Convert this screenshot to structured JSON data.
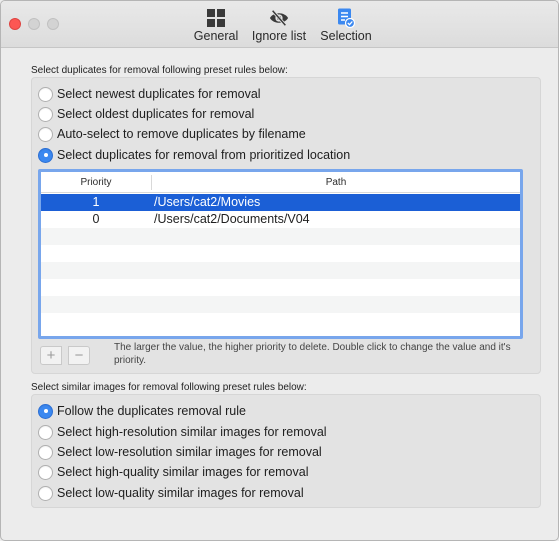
{
  "window": {
    "toolbar": [
      {
        "label": "General",
        "icon": "grid-icon"
      },
      {
        "label": "Ignore list",
        "icon": "eye-slash-icon"
      },
      {
        "label": "Selection",
        "icon": "checklist-icon"
      }
    ]
  },
  "duplicates": {
    "section_label": "Select duplicates for removal following preset rules below:",
    "options": [
      {
        "label": "Select newest duplicates for removal",
        "selected": false
      },
      {
        "label": "Select oldest duplicates for removal",
        "selected": false
      },
      {
        "label": "Auto-select to remove duplicates by filename",
        "selected": false
      },
      {
        "label": "Select duplicates for removal from prioritized location",
        "selected": true
      }
    ],
    "table": {
      "headers": [
        "Priority",
        "Path"
      ],
      "rows": [
        {
          "priority": "1",
          "path": "/Users/cat2/Movies",
          "selected": true
        },
        {
          "priority": "0",
          "path": "/Users/cat2/Documents/V04",
          "selected": false
        }
      ]
    },
    "add_label": "+",
    "remove_label": "−",
    "hint": "The larger the value, the higher priority to delete.  Double click to change the value and it's priority."
  },
  "similar": {
    "section_label": "Select similar images for removal following preset rules below:",
    "options": [
      {
        "label": "Follow the duplicates removal rule",
        "selected": true
      },
      {
        "label": "Select high-resolution similar images for removal",
        "selected": false
      },
      {
        "label": "Select low-resolution similar images for removal",
        "selected": false
      },
      {
        "label": "Select high-quality similar images for removal",
        "selected": false
      },
      {
        "label": "Select low-quality similar images for removal",
        "selected": false
      }
    ]
  },
  "colors": {
    "accent": "#3b88f0",
    "selection_row": "#1b5fd6",
    "close_button": "#fc5753"
  }
}
